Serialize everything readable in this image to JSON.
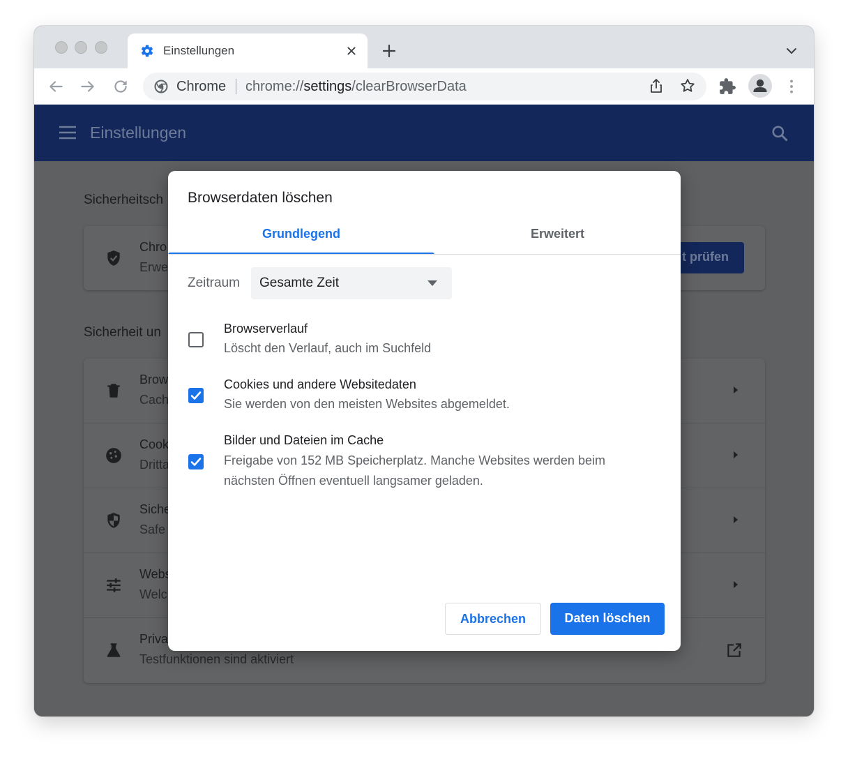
{
  "browser": {
    "tab_title": "Einstellungen",
    "omnibox": {
      "site_label": "Chrome",
      "url_scheme": "chrome://",
      "url_host": "settings",
      "url_path": "/clearBrowserData"
    }
  },
  "settings": {
    "title": "Einstellungen",
    "sections": [
      {
        "heading": "Sicherheitsch",
        "rows": [
          {
            "title": "Chro",
            "subtitle": "Erwe",
            "icon": "shield-check-icon",
            "action_label": "t prüfen"
          }
        ]
      },
      {
        "heading": "Sicherheit un",
        "rows": [
          {
            "title": "Brow",
            "subtitle": "Cach",
            "icon": "trash-icon"
          },
          {
            "title": "Cook",
            "subtitle": "Dritta",
            "icon": "cookie-icon"
          },
          {
            "title": "Siche",
            "subtitle": "Safe",
            "icon": "security-shield-icon"
          },
          {
            "title": "Webs",
            "subtitle": "Welc",
            "icon": "tune-sliders-icon"
          },
          {
            "title": "Priva",
            "subtitle": "Testfunktionen sind aktiviert",
            "icon": "flask-icon"
          }
        ]
      }
    ]
  },
  "dialog": {
    "title": "Browserdaten löschen",
    "tabs": [
      {
        "label": "Grundlegend",
        "active": true
      },
      {
        "label": "Erweitert",
        "active": false
      }
    ],
    "time_range": {
      "label": "Zeitraum",
      "value": "Gesamte Zeit"
    },
    "options": [
      {
        "title": "Browserverlauf",
        "description": "Löscht den Verlauf, auch im Suchfeld",
        "checked": false
      },
      {
        "title": "Cookies und andere Websitedaten",
        "description": "Sie werden von den meisten Websites abgemeldet.",
        "checked": true
      },
      {
        "title": "Bilder und Dateien im Cache",
        "description": "Freigabe von 152 MB Speicherplatz. Manche Websites werden beim nächsten Öffnen eventuell langsamer geladen.",
        "checked": true
      }
    ],
    "cancel_label": "Abbrechen",
    "confirm_label": "Daten löschen"
  },
  "colors": {
    "accent": "#1a73e8",
    "header_bg": "#13275a",
    "scrim": "#5f6061"
  }
}
